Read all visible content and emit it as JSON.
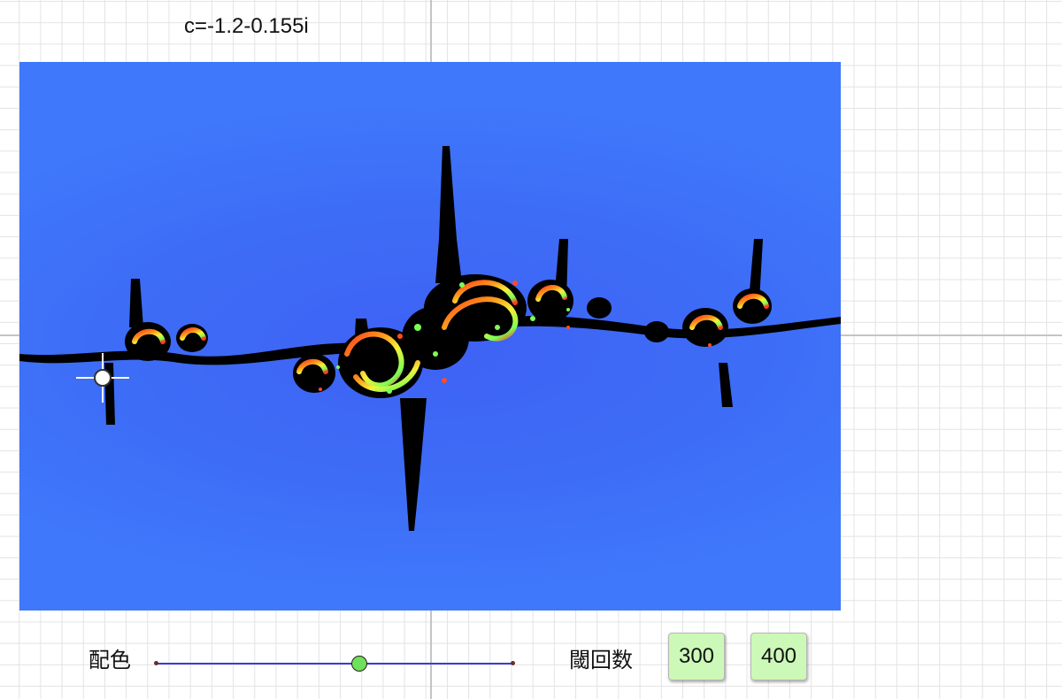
{
  "header": {
    "c_label": "c=-1.2-0.155i"
  },
  "controls": {
    "color_label": "配色",
    "color_slider_value": 0.57,
    "threshold_label": "閾回数",
    "buttons": [
      "300",
      "400"
    ]
  },
  "colors": {
    "background_blue": "#3f6ff8",
    "set_interior": "#000000",
    "button_fill": "#ccf8b8",
    "slider_track": "#3b3bdc",
    "slider_knob": "#6fe05b"
  }
}
